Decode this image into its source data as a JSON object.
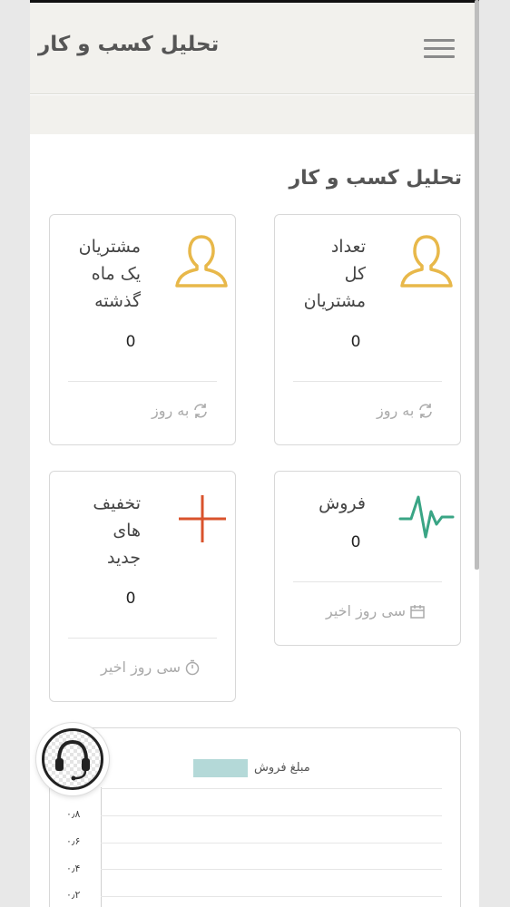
{
  "header": {
    "title": "تحلیل کسب و کار",
    "menu_icon": "hamburger-menu-icon"
  },
  "section": {
    "title": "تحلیل کسب و کار"
  },
  "cards": [
    {
      "id": "total-customers",
      "title_lines": [
        "تعداد",
        "کل",
        "مشتریان"
      ],
      "value": "0",
      "footer": "به روز",
      "icon": "user-icon",
      "footer_icon": "refresh-icon",
      "icon_color": "#e8b84a"
    },
    {
      "id": "last-month-customers",
      "title_lines": [
        "مشتریان",
        "یک ماه",
        "گذشته"
      ],
      "value": "0",
      "footer": "به روز",
      "icon": "user-icon",
      "footer_icon": "refresh-icon",
      "icon_color": "#e8b84a"
    },
    {
      "id": "sales",
      "title_lines": [
        "فروش"
      ],
      "value": "0",
      "footer": "سی روز اخیر",
      "icon": "pulse-icon",
      "footer_icon": "calendar-icon",
      "icon_color": "#3aa585"
    },
    {
      "id": "new-discounts",
      "title_lines": [
        "تخفیف",
        "های",
        "جدید"
      ],
      "value": "0",
      "footer": "سی روز اخیر",
      "icon": "plus-icon",
      "footer_icon": "timer-icon",
      "icon_color": "#d9532c"
    }
  ],
  "chart_data": {
    "type": "bar",
    "series": [
      {
        "name": "مبلغ فروش",
        "values": []
      }
    ],
    "categories": [],
    "ytick_labels": [
      "۰٫۸",
      "۰٫۶",
      "۰٫۴",
      "۰٫۲"
    ],
    "ylim": [
      0,
      1
    ],
    "legend_color": "#b4d9d8",
    "legend_position": "top"
  },
  "support": {
    "icon": "headset-support-icon"
  }
}
